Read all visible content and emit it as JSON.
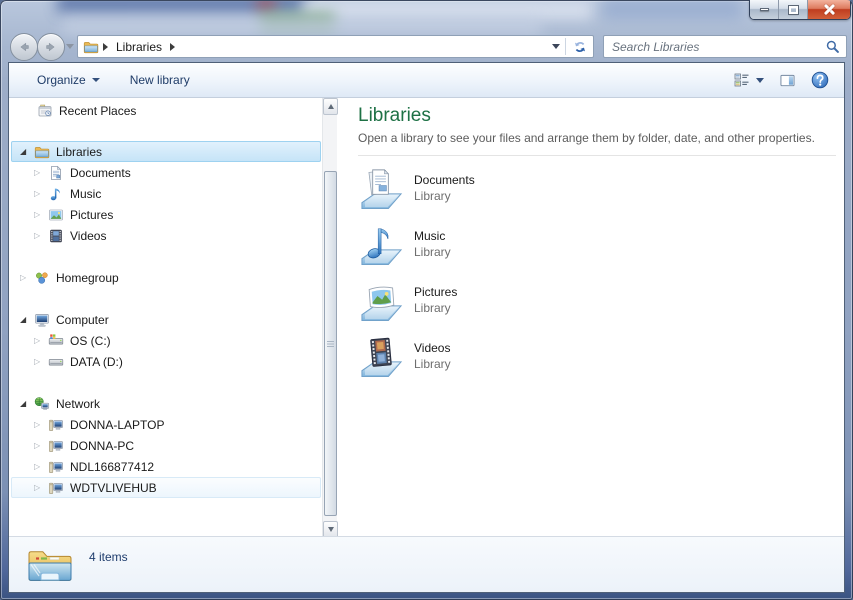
{
  "window": {
    "caption_buttons": [
      {
        "name": "minimize"
      },
      {
        "name": "maximize"
      },
      {
        "name": "close"
      }
    ]
  },
  "nav": {
    "breadcrumb_root": "Libraries",
    "search_placeholder": "Search Libraries"
  },
  "toolbar": {
    "organize_label": "Organize",
    "new_library_label": "New library"
  },
  "sidebar": {
    "items": [
      {
        "label": "Recent Places",
        "icon": "recent-places-icon",
        "expander": ""
      },
      {
        "label": "Libraries",
        "icon": "libraries-icon",
        "expander": "◢",
        "state": "selected"
      },
      {
        "label": "Documents",
        "icon": "documents-icon",
        "expander": "▷"
      },
      {
        "label": "Music",
        "icon": "music-icon",
        "expander": "▷"
      },
      {
        "label": "Pictures",
        "icon": "pictures-icon",
        "expander": "▷"
      },
      {
        "label": "Videos",
        "icon": "videos-icon",
        "expander": "▷"
      },
      {
        "label": "Homegroup",
        "icon": "homegroup-icon",
        "expander": "▷"
      },
      {
        "label": "Computer",
        "icon": "computer-icon",
        "expander": "◢"
      },
      {
        "label": "OS (C:)",
        "icon": "os-drive-icon",
        "expander": "▷"
      },
      {
        "label": "DATA (D:)",
        "icon": "data-drive-icon",
        "expander": "▷"
      },
      {
        "label": "Network",
        "icon": "network-icon",
        "expander": "◢"
      },
      {
        "label": "DONNA-LAPTOP",
        "icon": "network-computer-icon",
        "expander": "▷"
      },
      {
        "label": "DONNA-PC",
        "icon": "network-computer-icon",
        "expander": "▷"
      },
      {
        "label": "NDL166877412",
        "icon": "network-computer-icon",
        "expander": "▷"
      },
      {
        "label": "WDTVLIVEHUB",
        "icon": "network-computer-icon",
        "expander": "▷",
        "state": "hover"
      }
    ]
  },
  "main": {
    "title": "Libraries",
    "subtitle": "Open a library to see your files and arrange them by folder, date, and other properties.",
    "items": [
      {
        "name": "Documents",
        "type": "Library",
        "icon": "documents-library-icon"
      },
      {
        "name": "Music",
        "type": "Library",
        "icon": "music-library-icon"
      },
      {
        "name": "Pictures",
        "type": "Library",
        "icon": "pictures-library-icon"
      },
      {
        "name": "Videos",
        "type": "Library",
        "icon": "videos-library-icon"
      }
    ]
  },
  "statusbar": {
    "items_count": "4 items"
  },
  "colors": {
    "header_green": "#1e7145",
    "toolbar_text_blue": "#1f3c68",
    "selection_blue": "#c6e4f8",
    "close_button_red": "#bf3d20"
  }
}
